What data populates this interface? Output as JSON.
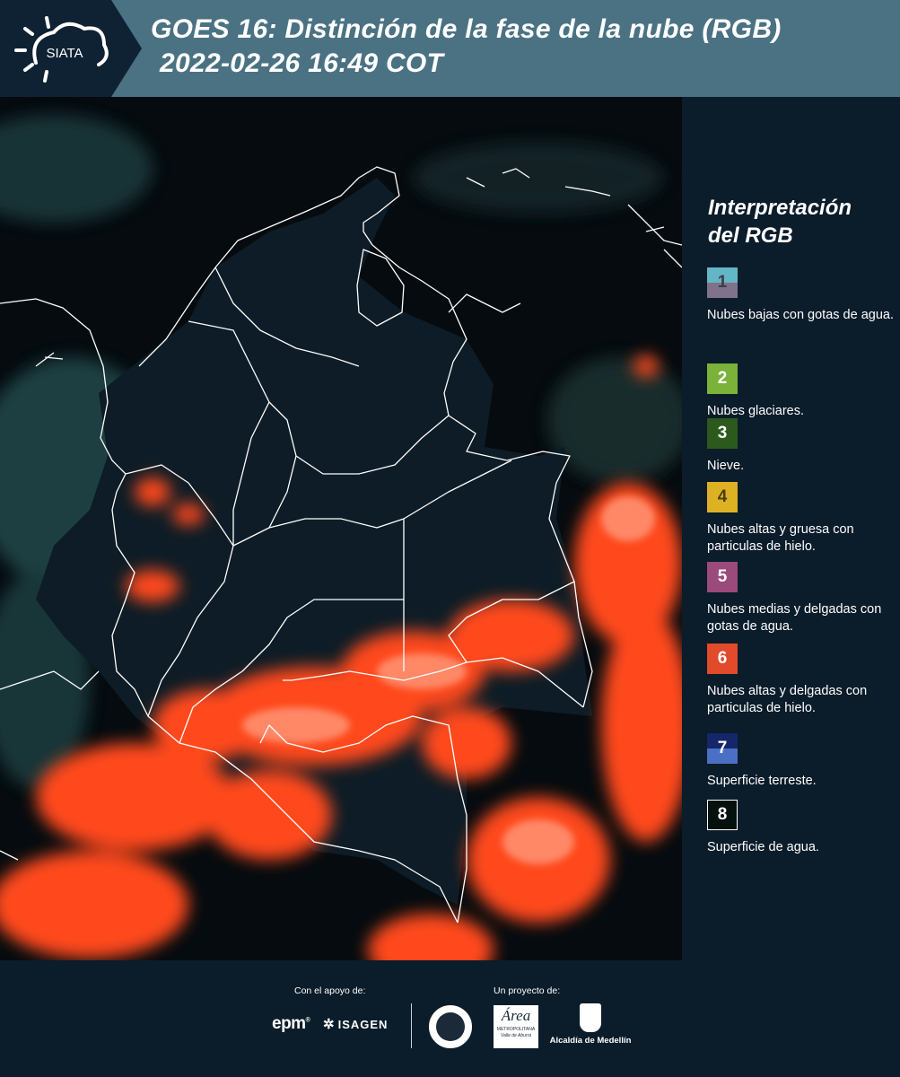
{
  "header": {
    "logo_text": "SIATA",
    "title_line1": "GOES 16: Distinción de la fase de la nube (RGB)",
    "title_line2": "2022-02-26 16:49 COT"
  },
  "legend": {
    "title": "Interpretación del RGB",
    "items": [
      {
        "number": "1",
        "label": "Nubes bajas con gotas de agua.",
        "color_top": "#63b6c6",
        "color_bottom": "#7f7289",
        "text_color": "#3d3d4a"
      },
      {
        "number": "2",
        "label": "Nubes glaciares.",
        "color_top": "#7ab23a",
        "color_bottom": "#7ab23a",
        "text_color": "#ffffff"
      },
      {
        "number": "3",
        "label": "Nieve.",
        "color_top": "#2c5a1c",
        "color_bottom": "#2c5a1c",
        "text_color": "#ffffff"
      },
      {
        "number": "4",
        "label": "Nubes altas y gruesa con particulas de hielo.",
        "color_top": "#ddb124",
        "color_bottom": "#ddb124",
        "text_color": "#4a3d12"
      },
      {
        "number": "5",
        "label": "Nubes medias y delgadas con gotas de agua.",
        "color_top": "#9b4a7c",
        "color_bottom": "#9b4a7c",
        "text_color": "#ffffff"
      },
      {
        "number": "6",
        "label": "Nubes altas y delgadas con particulas de hielo.",
        "color_top": "#e24a2c",
        "color_bottom": "#e24a2c",
        "text_color": "#ffffff"
      },
      {
        "number": "7",
        "label": "Superficie terreste.",
        "color_top": "#15276a",
        "color_bottom": "#4a6fc4",
        "text_color": "#ffffff"
      },
      {
        "number": "8",
        "label": "Superficie de agua.",
        "color_top": "#05110c",
        "color_bottom": "#05110c",
        "text_color": "#ffffff"
      }
    ]
  },
  "footer": {
    "support_caption": "Con el apoyo de:",
    "project_caption": "Un proyecto de:",
    "logo_epm": "epm",
    "logo_isagen": "ISAGEN",
    "logo_area_name": "Área",
    "logo_area_sub1": "METROPOLITANA",
    "logo_area_sub2": "Valle de Aburrá",
    "logo_alcaldia": "Alcaldía de Medellín"
  },
  "colors": {
    "header_bg": "#4b7283",
    "logo_bg": "#0f2233",
    "page_bg": "#0b1c2a",
    "cloud_ice": "#ff4a1c",
    "land": "#0c1a24"
  }
}
